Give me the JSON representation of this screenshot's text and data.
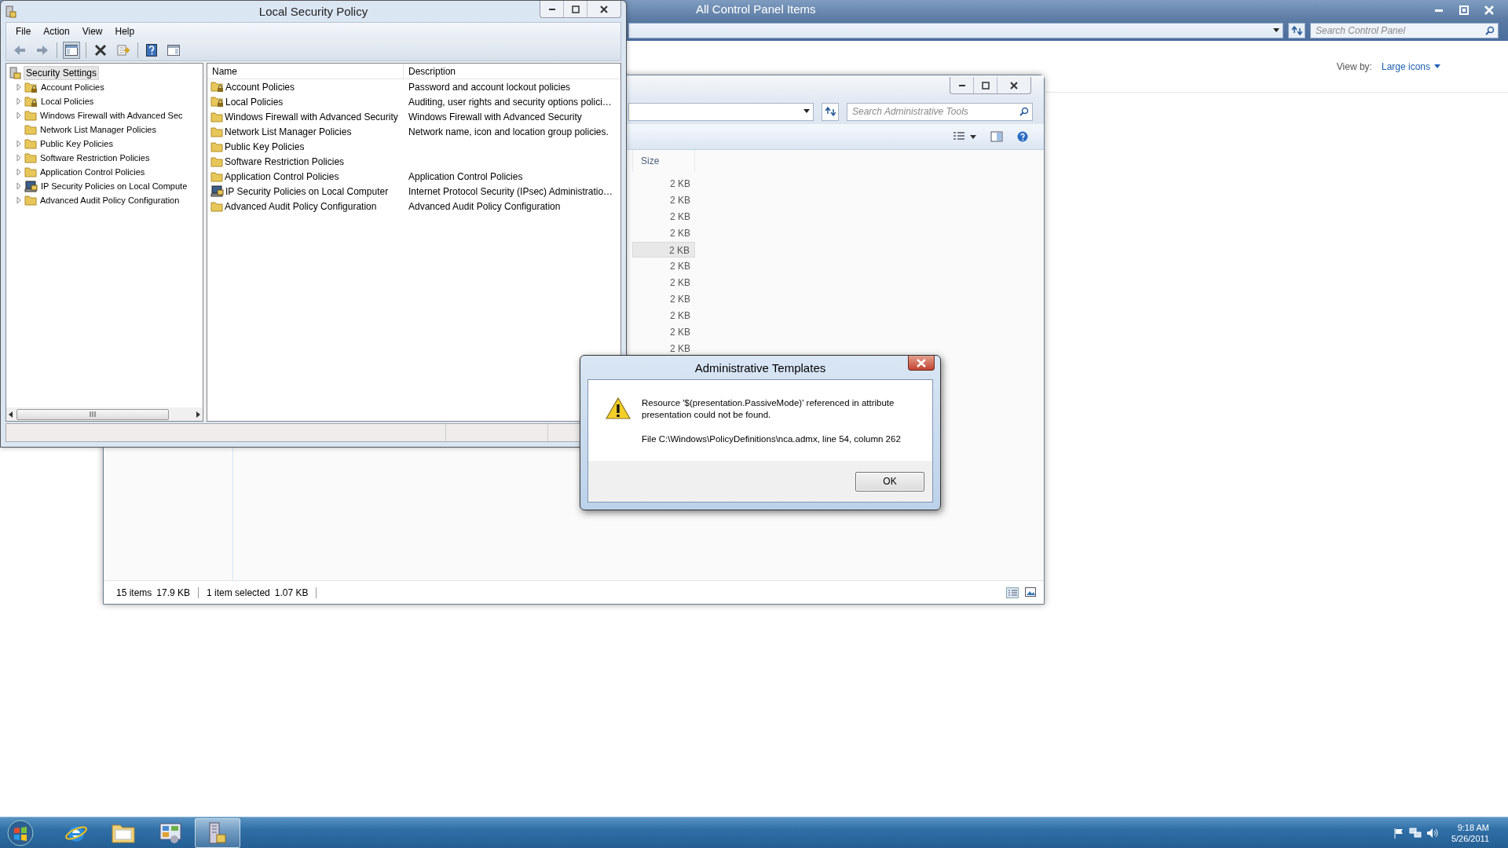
{
  "control_panel": {
    "title": "All Control Panel Items",
    "search": {
      "placeholder": "Search Control Panel"
    },
    "view_by": {
      "label": "View by:",
      "value": "Large icons"
    }
  },
  "admin_tools": {
    "search": {
      "placeholder": "Search Administrative Tools"
    },
    "columns": [
      "Size"
    ],
    "rows": [
      {
        "size": "2 KB",
        "selected": false
      },
      {
        "size": "2 KB",
        "selected": false
      },
      {
        "size": "2 KB",
        "selected": false
      },
      {
        "size": "2 KB",
        "selected": false
      },
      {
        "size": "2 KB",
        "selected": true
      },
      {
        "size": "2 KB",
        "selected": false
      },
      {
        "size": "2 KB",
        "selected": false
      },
      {
        "size": "2 KB",
        "selected": false
      },
      {
        "size": "2 KB",
        "selected": false
      },
      {
        "size": "2 KB",
        "selected": false
      },
      {
        "size": "2 KB",
        "selected": false
      }
    ],
    "status_bar": [
      {
        "count": "15 items",
        "size": "17.9 KB"
      },
      {
        "count": "1 item selected",
        "size": "1.07 KB"
      }
    ]
  },
  "local_security_policy": {
    "title": "Local Security Policy",
    "menu": [
      "File",
      "Action",
      "View",
      "Help"
    ],
    "tree": {
      "label": "Security Settings",
      "selected": true,
      "children": [
        {
          "label": "Account Policies",
          "kind": "locked-folder",
          "has_children": true,
          "selected": false
        },
        {
          "label": "Local Policies",
          "kind": "locked-folder",
          "has_children": true,
          "selected": false
        },
        {
          "label": "Windows Firewall with Advanced Sec",
          "kind": "folder",
          "has_children": true,
          "selected": false
        },
        {
          "label": "Network List Manager Policies",
          "kind": "folder",
          "has_children": false,
          "selected": false
        },
        {
          "label": "Public Key Policies",
          "kind": "folder",
          "has_children": true,
          "selected": false
        },
        {
          "label": "Software Restriction Policies",
          "kind": "folder",
          "has_children": true,
          "selected": false
        },
        {
          "label": "Application Control Policies",
          "kind": "folder",
          "has_children": true,
          "selected": false
        },
        {
          "label": "IP Security Policies on Local Compute",
          "kind": "security",
          "has_children": true,
          "selected": false
        },
        {
          "label": "Advanced Audit Policy Configuration",
          "kind": "folder",
          "has_children": true,
          "selected": false
        }
      ]
    },
    "columns": [
      "Name",
      "Description"
    ],
    "rows": [
      {
        "name": "Account Policies",
        "description": "Password and account lockout policies",
        "kind": "locked-folder"
      },
      {
        "name": "Local Policies",
        "description": "Auditing, user rights and security options polici…",
        "kind": "locked-folder"
      },
      {
        "name": "Windows Firewall with Advanced Security",
        "description": "Windows Firewall with Advanced Security",
        "kind": "folder"
      },
      {
        "name": "Network List Manager Policies",
        "description": "Network name, icon and location group policies.",
        "kind": "folder"
      },
      {
        "name": "Public Key Policies",
        "kind": "folder"
      },
      {
        "name": "Software Restriction Policies",
        "kind": "folder"
      },
      {
        "name": "Application Control Policies",
        "description": "Application Control Policies",
        "kind": "folder"
      },
      {
        "name": "IP Security Policies on Local Computer",
        "description": "Internet Protocol Security (IPsec) Administratio…",
        "kind": "security"
      },
      {
        "name": "Advanced Audit Policy Configuration",
        "description": "Advanced Audit Policy Configuration",
        "kind": "folder"
      }
    ]
  },
  "dialog": {
    "title": "Administrative Templates",
    "message": "Resource '$(presentation.PassiveMode)' referenced in attribute presentation could not be found.",
    "detail": "File C:\\Windows\\PolicyDefinitions\\nca.admx, line 54, column 262",
    "button": "OK"
  },
  "taskbar": {
    "items": [
      {
        "kind": "browser",
        "selected": false
      },
      {
        "kind": "explorer",
        "selected": false
      },
      {
        "kind": "control-panel",
        "selected": false
      },
      {
        "kind": "security-policy",
        "selected": true
      }
    ],
    "time": "9:18 AM",
    "date": "5/26/2011"
  }
}
